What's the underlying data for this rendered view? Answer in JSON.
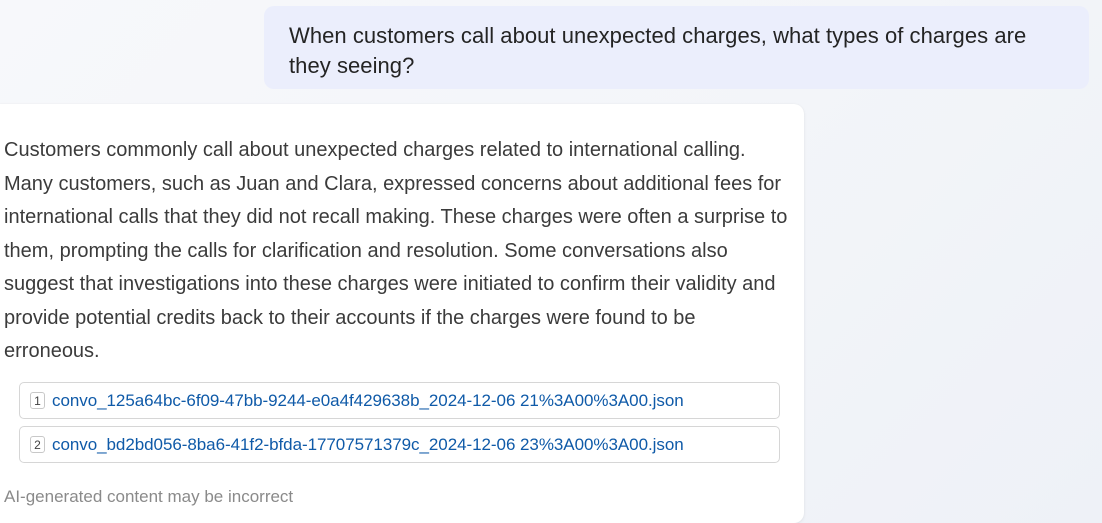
{
  "user_message": {
    "text": "When customers call about unexpected charges, what types of charges are they seeing?"
  },
  "assistant_message": {
    "text": "Customers commonly call about unexpected charges related to international calling. Many customers, such as Juan and Clara, expressed concerns about additional fees for international calls that they did not recall making. These charges were often a surprise to them, prompting the calls for clarification and resolution. Some conversations also suggest that investigations into these charges were initiated to confirm their validity and provide potential credits back to their accounts if the charges were found to be erroneous.",
    "citations": [
      {
        "number": "1",
        "label": "convo_125a64bc-6f09-47bb-9244-e0a4f429638b_2024-12-06 21%3A00%3A00.json"
      },
      {
        "number": "2",
        "label": "convo_bd2bd056-8ba6-41f2-bfda-17707571379c_2024-12-06 23%3A00%3A00.json"
      }
    ],
    "disclaimer": "AI-generated content may be incorrect"
  },
  "colors": {
    "user_bubble_bg": "#ebeefc",
    "link": "#0f5aa8",
    "muted_text": "#8a8a8a"
  }
}
